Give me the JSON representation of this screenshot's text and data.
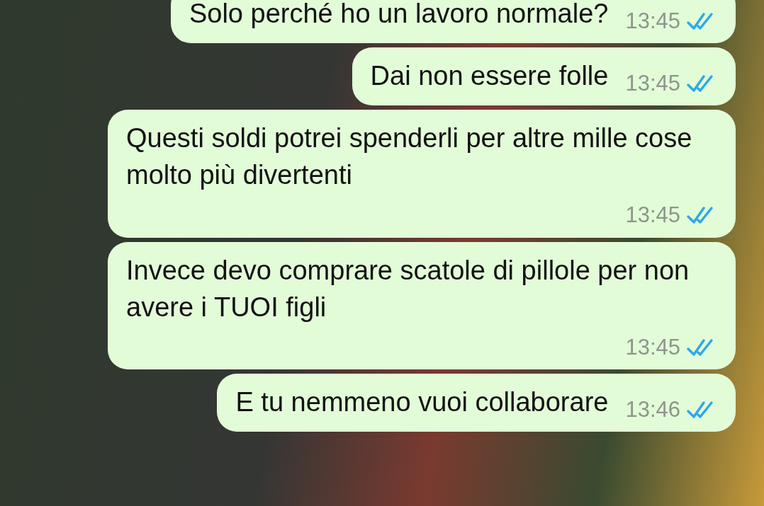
{
  "messages": [
    {
      "text": "Solo perché ho un lavoro normale?",
      "time": "13:45",
      "read": true
    },
    {
      "text": "Dai non essere folle",
      "time": "13:45",
      "read": true
    },
    {
      "text": "Questi soldi potrei spenderli per altre mille cose molto più divertenti",
      "time": "13:45",
      "read": true
    },
    {
      "text": "Invece devo comprare scatole di pillole per non avere i TUOI figli",
      "time": "13:45",
      "read": true
    },
    {
      "text": "E tu nemmeno vuoi collaborare",
      "time": "13:46",
      "read": true
    }
  ]
}
